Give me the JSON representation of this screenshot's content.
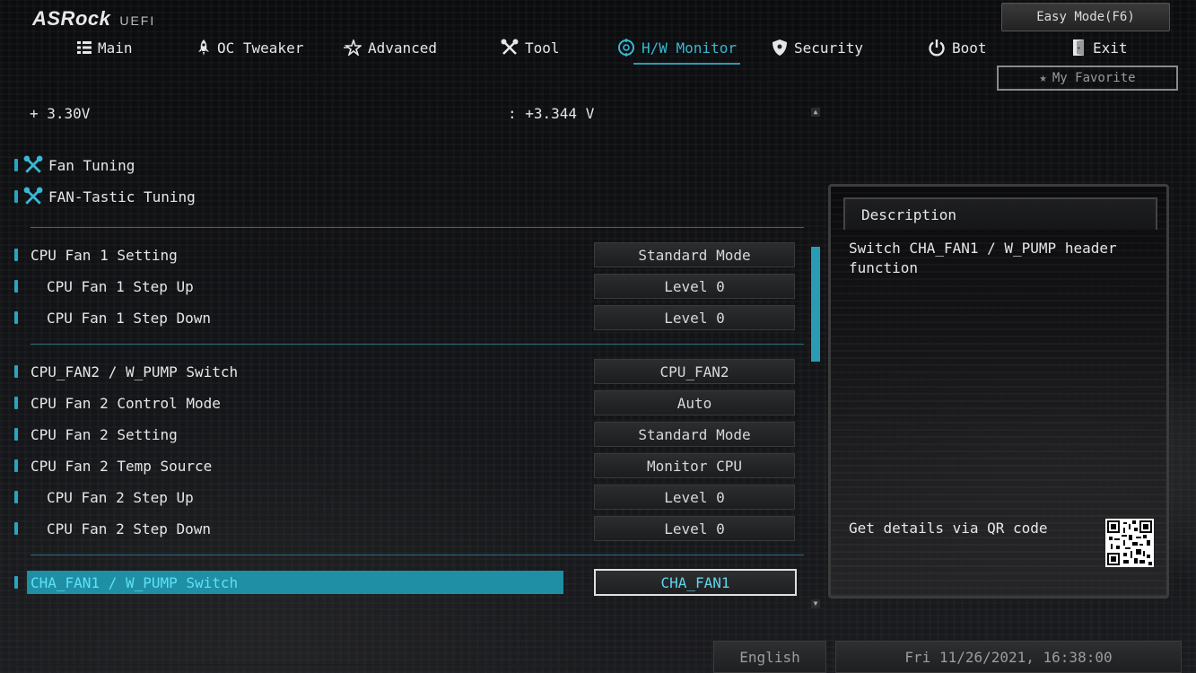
{
  "header": {
    "brand": "ASRock",
    "brand_sub": "UEFI",
    "easy_mode_label": "Easy Mode(F6)",
    "my_favorite_label": "My Favorite"
  },
  "tabs": [
    {
      "label": "Main",
      "icon": "list-icon",
      "active": false
    },
    {
      "label": "OC Tweaker",
      "icon": "rocket-icon",
      "active": false
    },
    {
      "label": "Advanced",
      "icon": "star-icon",
      "active": false
    },
    {
      "label": "Tool",
      "icon": "tools-icon",
      "active": false
    },
    {
      "label": "H/W Monitor",
      "icon": "monitor-icon",
      "active": true
    },
    {
      "label": "Security",
      "icon": "shield-icon",
      "active": false
    },
    {
      "label": "Boot",
      "icon": "power-icon",
      "active": false
    },
    {
      "label": "Exit",
      "icon": "exit-icon",
      "active": false
    }
  ],
  "voltage": {
    "label": "+ 3.30V",
    "value": ": +3.344 V"
  },
  "tools": [
    {
      "label": "Fan Tuning",
      "icon": "tools-icon"
    },
    {
      "label": "FAN-Tastic Tuning",
      "icon": "tools-icon"
    }
  ],
  "settings": [
    {
      "label": "CPU Fan 1 Setting",
      "value": "Standard Mode",
      "indent": false
    },
    {
      "label": "CPU Fan 1 Step Up",
      "value": "Level 0",
      "indent": true
    },
    {
      "label": "CPU Fan 1 Step Down",
      "value": "Level 0",
      "indent": true
    },
    {
      "label": "CPU_FAN2 / W_PUMP Switch",
      "value": "CPU_FAN2",
      "indent": false
    },
    {
      "label": "CPU Fan 2 Control Mode",
      "value": "Auto",
      "indent": false
    },
    {
      "label": "CPU Fan 2 Setting",
      "value": "Standard Mode",
      "indent": false
    },
    {
      "label": "CPU Fan 2 Temp Source",
      "value": "Monitor CPU",
      "indent": false
    },
    {
      "label": "CPU Fan 2 Step Up",
      "value": "Level 0",
      "indent": true
    },
    {
      "label": "CPU Fan 2 Step Down",
      "value": "Level 0",
      "indent": true
    },
    {
      "label": "CHA_FAN1 / W_PUMP Switch",
      "value": "CHA_FAN1",
      "indent": false,
      "selected": true
    }
  ],
  "description": {
    "title": "Description",
    "text": "Switch CHA_FAN1 / W_PUMP header function",
    "qr_label": "Get details via QR code"
  },
  "footer": {
    "language": "English",
    "datetime": "Fri 11/26/2021, 16:38:00"
  },
  "colors": {
    "accent": "#2a9bb4",
    "selected_text": "#5fe0f5",
    "background": "#0d0e10"
  }
}
